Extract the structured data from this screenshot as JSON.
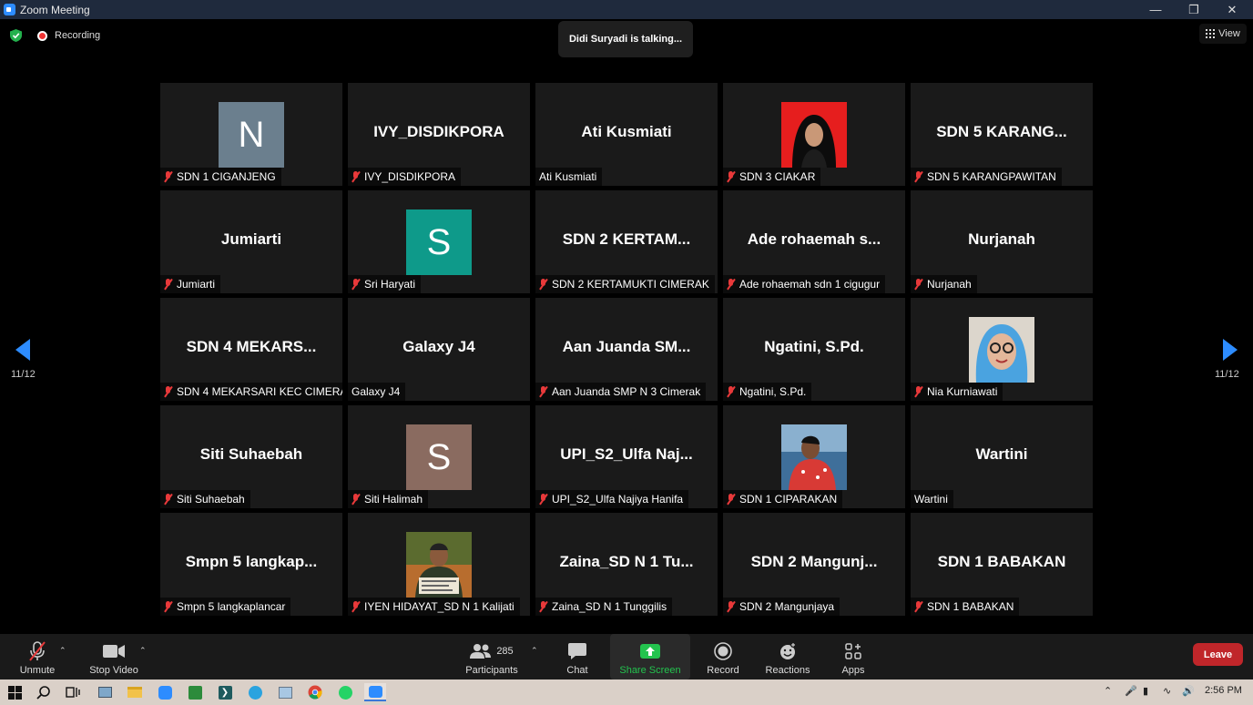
{
  "window": {
    "title": "Zoom Meeting"
  },
  "status": {
    "recording_label": "Recording",
    "talking": "Didi Suryadi is talking...",
    "view_label": "View"
  },
  "pager": {
    "left": "11/12",
    "right": "11/12"
  },
  "tiles": [
    {
      "big": "",
      "avatar_letter": "N",
      "avatar_color": "#6b7f8e",
      "label": "SDN 1 CIGANJENG",
      "muted": true,
      "photo": false
    },
    {
      "big": "IVY_DISDIKPORA",
      "label": "IVY_DISDIKPORA",
      "muted": true
    },
    {
      "big": "Ati Kusmiati",
      "label": "Ati Kusmiati",
      "muted": false
    },
    {
      "big": "",
      "photo": "hijab",
      "label": "SDN 3 CIAKAR",
      "muted": true
    },
    {
      "big": "SDN 5 KARANG...",
      "label": "SDN 5 KARANGPAWITAN",
      "muted": true
    },
    {
      "big": "Jumiarti",
      "label": "Jumiarti",
      "muted": true
    },
    {
      "big": "",
      "avatar_letter": "S",
      "avatar_color": "#0e9a8a",
      "label": "Sri Haryati",
      "muted": true
    },
    {
      "big": "SDN 2 KERTAM...",
      "label": "SDN 2 KERTAMUKTI CIMERAK",
      "muted": true
    },
    {
      "big": "Ade rohaemah s...",
      "label": "Ade rohaemah sdn 1 cigugur",
      "muted": true
    },
    {
      "big": "Nurjanah",
      "label": "Nurjanah",
      "muted": true
    },
    {
      "big": "SDN 4 MEKARS...",
      "label": "SDN 4 MEKARSARI KEC CIMERAK",
      "muted": true
    },
    {
      "big": "Galaxy J4",
      "label": "Galaxy J4",
      "muted": false
    },
    {
      "big": "Aan Juanda SM...",
      "label": "Aan Juanda SMP N 3 Cimerak",
      "muted": true
    },
    {
      "big": "Ngatini, S.Pd.",
      "label": "Ngatini, S.Pd.",
      "muted": true
    },
    {
      "big": "",
      "photo": "glasses",
      "label": "Nia Kurniawati",
      "muted": true
    },
    {
      "big": "Siti Suhaebah",
      "label": "Siti Suhaebah",
      "muted": true
    },
    {
      "big": "",
      "avatar_letter": "S",
      "avatar_color": "#8a6b60",
      "label": "Siti Halimah",
      "muted": true
    },
    {
      "big": "UPI_S2_Ulfa Naj...",
      "label": "UPI_S2_Ulfa Najiya Hanifa",
      "muted": true
    },
    {
      "big": "",
      "photo": "redshirt",
      "label": "SDN 1 CIPARAKAN",
      "muted": true
    },
    {
      "big": "Wartini",
      "label": "Wartini",
      "muted": false
    },
    {
      "big": "Smpn 5 langkap...",
      "label": "Smpn 5 langkaplancar",
      "muted": true
    },
    {
      "big": "",
      "photo": "forest",
      "label": "IYEN HIDAYAT_SD N 1 Kalijati",
      "muted": true
    },
    {
      "big": "Zaina_SD N 1 Tu...",
      "label": "Zaina_SD N 1 Tunggilis",
      "muted": true
    },
    {
      "big": "SDN 2 Mangunj...",
      "label": "SDN 2 Mangunjaya",
      "muted": true
    },
    {
      "big": "SDN 1 BABAKAN",
      "label": "SDN 1 BABAKAN",
      "muted": true
    }
  ],
  "toolbar": {
    "unmute": "Unmute",
    "stop_video": "Stop Video",
    "participants": "Participants",
    "participant_count": "285",
    "chat": "Chat",
    "share_screen": "Share Screen",
    "record": "Record",
    "reactions": "Reactions",
    "apps": "Apps",
    "leave": "Leave"
  },
  "taskbar": {
    "time": "2:56 PM"
  },
  "colors": {
    "accent": "#2d8cff",
    "share_green": "#23c34e",
    "leave_red": "#c0262a",
    "mute_red": "#e8393a"
  }
}
